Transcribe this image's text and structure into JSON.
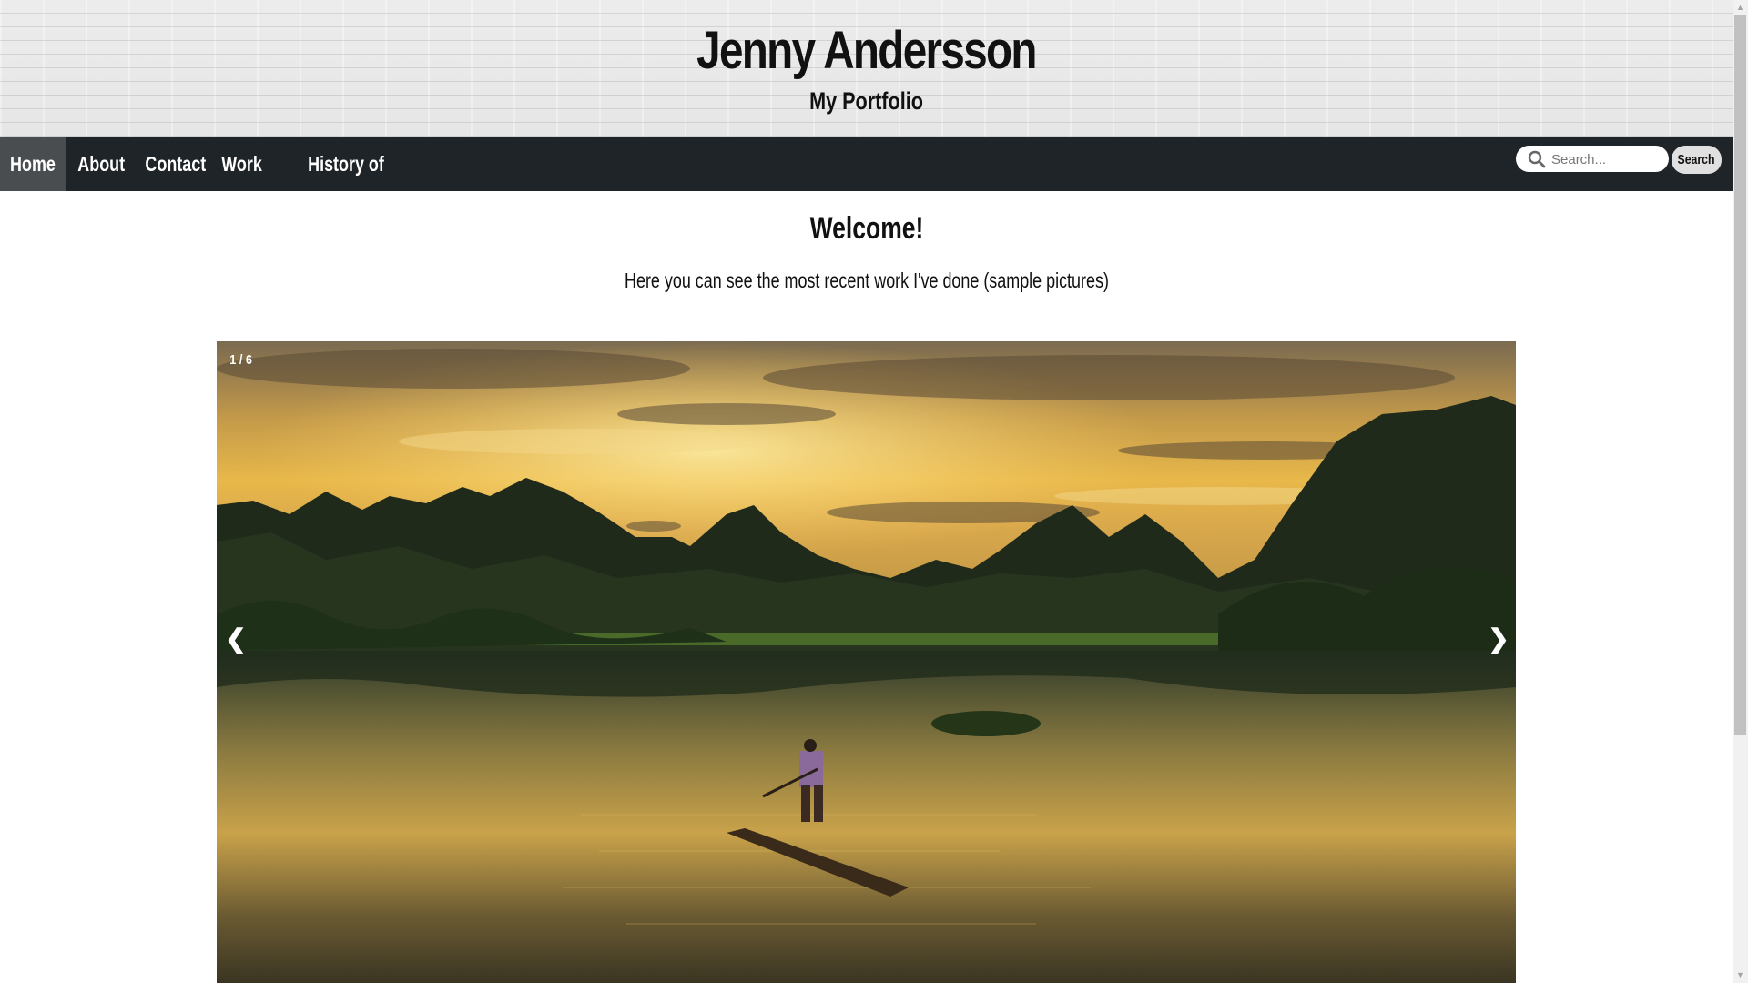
{
  "header": {
    "title": "Jenny Andersson",
    "subtitle": "My Portfolio"
  },
  "nav": {
    "items": [
      {
        "label": "Home",
        "active": true
      },
      {
        "label": "About",
        "active": false
      },
      {
        "label": "Contact",
        "active": false
      },
      {
        "label": "Work",
        "active": false
      },
      {
        "label": "History of Internet",
        "active": false
      }
    ],
    "search": {
      "placeholder": "Search...",
      "value": "",
      "button_label": "Search",
      "icon": "search-icon"
    }
  },
  "main": {
    "heading": "Welcome!",
    "intro": "Here you can see the most recent work I've done (sample pictures)"
  },
  "slideshow": {
    "counter": "1 / 6",
    "prev_label": "❮",
    "next_label": "❯",
    "current_image": "landscape-sunset-river"
  },
  "colors": {
    "nav_background": "#1f2428",
    "nav_active": "#4a4d50",
    "text": "#111111"
  }
}
